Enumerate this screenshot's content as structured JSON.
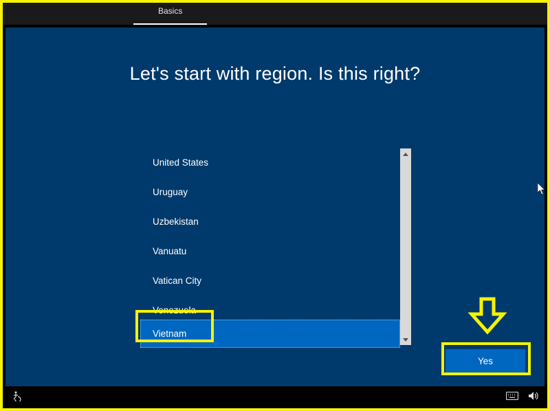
{
  "tab": {
    "label": "Basics"
  },
  "heading": "Let's start with region. Is this right?",
  "regions": {
    "items": [
      {
        "label": "United States"
      },
      {
        "label": "Uruguay"
      },
      {
        "label": "Uzbekistan"
      },
      {
        "label": "Vanuatu"
      },
      {
        "label": "Vatican City"
      },
      {
        "label": "Venezuela"
      },
      {
        "label": "Vietnam"
      }
    ],
    "selected_index": 6
  },
  "buttons": {
    "yes": "Yes"
  }
}
